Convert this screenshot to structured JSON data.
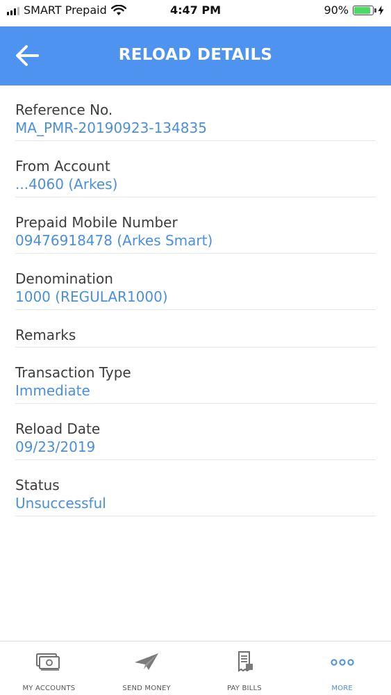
{
  "status_bar": {
    "carrier": "SMART Prepaid",
    "time": "4:47 PM",
    "battery": "90%",
    "battery_level": 0.9
  },
  "header": {
    "title": "RELOAD DETAILS",
    "back_icon": "back-arrow-icon"
  },
  "details": [
    {
      "label": "Reference No.",
      "value": "MA_PMR-20190923-134835"
    },
    {
      "label": "From Account",
      "value": "...4060 (Arkes)"
    },
    {
      "label": "Prepaid Mobile Number",
      "value": "09476918478 (Arkes Smart)"
    },
    {
      "label": "Denomination",
      "value": "1000 (REGULAR1000)"
    },
    {
      "label": "Remarks",
      "value": ""
    },
    {
      "label": "Transaction Type",
      "value": "Immediate"
    },
    {
      "label": "Reload Date",
      "value": "09/23/2019"
    },
    {
      "label": "Status",
      "value": "Unsuccessful"
    }
  ],
  "bottom_nav": [
    {
      "label": "MY ACCOUNTS",
      "icon": "accounts-icon",
      "active": false
    },
    {
      "label": "SEND MONEY",
      "icon": "paper-plane-icon",
      "active": false
    },
    {
      "label": "PAY BILLS",
      "icon": "bill-icon",
      "active": false
    },
    {
      "label": "MORE",
      "icon": "more-dots-icon",
      "active": true
    }
  ],
  "colors": {
    "header_bg": "#4f93f0",
    "value_text": "#4a8fdc",
    "active_nav": "#4a8fdc",
    "battery": "#4cd964"
  }
}
